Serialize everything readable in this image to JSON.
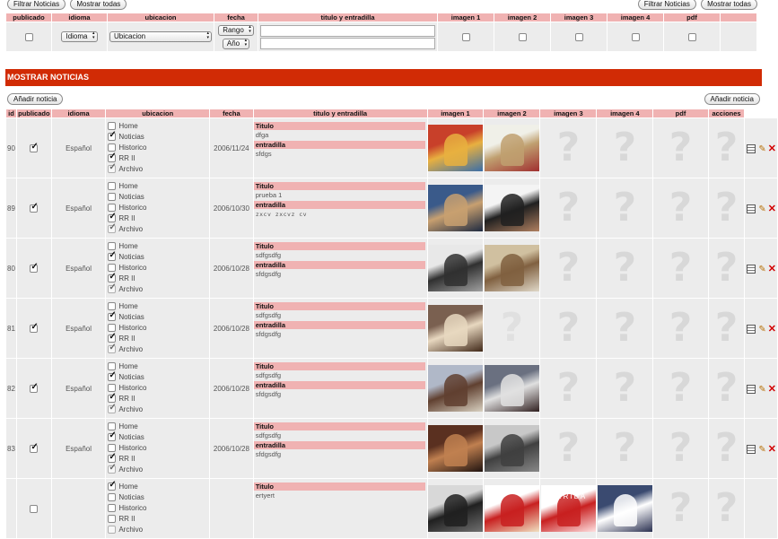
{
  "top_actions": {
    "filter": "Filtrar Noticias",
    "show_all": "Mostrar todas"
  },
  "filter_columns": [
    "publicado",
    "idioma",
    "ubicacion",
    "fecha",
    "titulo y entradilla",
    "imagen 1",
    "imagen 2",
    "imagen 3",
    "imagen 4",
    "pdf"
  ],
  "filters": {
    "idioma": "Idioma",
    "ubicacion": "Ubicacion",
    "fecha_rango": "Rango",
    "fecha_anio": "Año",
    "titulo_value": "",
    "entradilla_value": ""
  },
  "section_title": "MOSTRAR NOTICIAS",
  "add_label": "Añadir noticia",
  "news_columns": [
    "id",
    "publicado",
    "idioma",
    "ubicacion",
    "fecha",
    "titulo y entradilla",
    "imagen 1",
    "imagen 2",
    "imagen 3",
    "imagen 4",
    "pdf",
    "acciones"
  ],
  "location_labels": [
    "Home",
    "Noticias",
    "Historico",
    "RR II",
    "Archivo"
  ],
  "title_label": "Titulo",
  "entradilla_label": "entradilla",
  "rows": [
    {
      "id": "90",
      "publicado": true,
      "idioma": "Español",
      "fecha": "2006/11/24",
      "ubic": [
        false,
        true,
        false,
        true,
        true
      ],
      "titulo": "dfga",
      "entradilla": "sfdgs",
      "imgs": [
        "photo",
        "photo",
        "none",
        "none",
        "none"
      ]
    },
    {
      "id": "89",
      "publicado": true,
      "idioma": "Español",
      "fecha": "2006/10/30",
      "ubic": [
        false,
        false,
        false,
        true,
        true
      ],
      "titulo": "prueba 1",
      "entradilla": "zxcv zxcvz cv",
      "imgs": [
        "photo",
        "photo",
        "none",
        "none",
        "none"
      ]
    },
    {
      "id": "80",
      "publicado": true,
      "idioma": "Español",
      "fecha": "2006/10/28",
      "ubic": [
        false,
        true,
        false,
        true,
        true
      ],
      "titulo": "sdfgsdfg",
      "entradilla": "sfdgsdfg",
      "imgs": [
        "photo",
        "photo",
        "none",
        "none",
        "none"
      ]
    },
    {
      "id": "81",
      "publicado": true,
      "idioma": "Español",
      "fecha": "2006/10/28",
      "ubic": [
        false,
        true,
        false,
        true,
        true
      ],
      "titulo": "sdfgsdfg",
      "entradilla": "sfdgsdfg",
      "imgs": [
        "photo",
        "none",
        "none",
        "none",
        "none"
      ]
    },
    {
      "id": "82",
      "publicado": true,
      "idioma": "Español",
      "fecha": "2006/10/28",
      "ubic": [
        false,
        true,
        false,
        true,
        true
      ],
      "titulo": "sdfgsdfg",
      "entradilla": "sfdgsdfg",
      "imgs": [
        "photo",
        "photo",
        "none",
        "none",
        "none"
      ]
    },
    {
      "id": "83",
      "publicado": true,
      "idioma": "Español",
      "fecha": "2006/10/28",
      "ubic": [
        false,
        true,
        false,
        true,
        true
      ],
      "titulo": "sdfgsdfg",
      "entradilla": "sfdgsdfg",
      "imgs": [
        "photo",
        "photo",
        "none",
        "none",
        "none"
      ]
    },
    {
      "id": "",
      "publicado": false,
      "idioma": "",
      "fecha": "",
      "ubic": [
        true,
        false,
        false,
        false,
        false
      ],
      "titulo": "ertyert",
      "entradilla": "",
      "imgs": [
        "photo",
        "photo",
        "photo",
        "photo",
        "none"
      ]
    }
  ],
  "image_overlay_texts": {
    "row7_img3": "ARRIBA"
  },
  "colors": {
    "accent_red": "#d12b05",
    "header_pink": "#f0b2b2",
    "cell_grey": "#ececec",
    "delete_red": "#d30000"
  }
}
